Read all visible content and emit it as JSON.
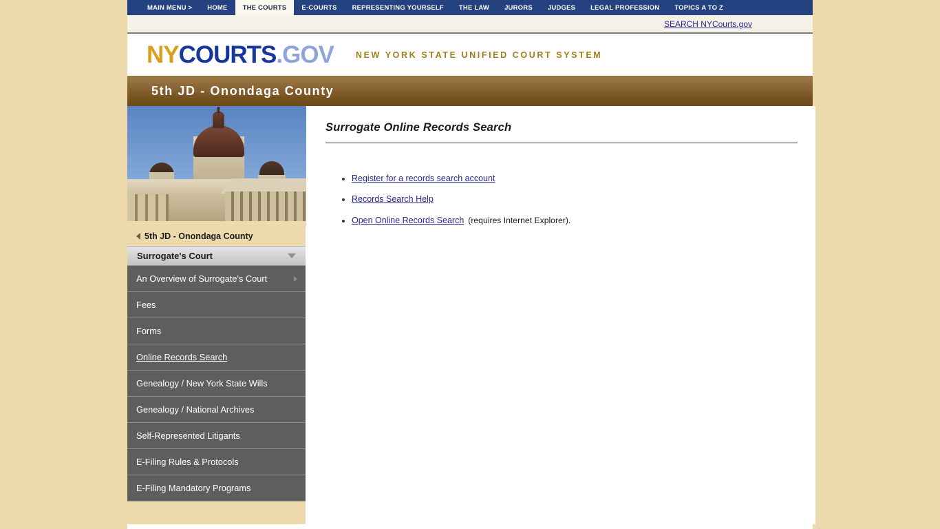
{
  "topnav": {
    "items": [
      {
        "label": "MAIN MENU >",
        "active": false
      },
      {
        "label": "HOME",
        "active": false
      },
      {
        "label": "THE COURTS",
        "active": true
      },
      {
        "label": "E-COURTS",
        "active": false
      },
      {
        "label": "REPRESENTING YOURSELF",
        "active": false
      },
      {
        "label": "THE LAW",
        "active": false
      },
      {
        "label": "JURORS",
        "active": false
      },
      {
        "label": "JUDGES",
        "active": false
      },
      {
        "label": "LEGAL PROFESSION",
        "active": false
      },
      {
        "label": "TOPICS A TO Z",
        "active": false
      }
    ]
  },
  "search": {
    "link_label": "SEARCH NYCourts.gov"
  },
  "logo": {
    "part_ny": "NY",
    "part_courts": "COURTS",
    "part_dot": ".",
    "part_gov": "GOV",
    "tagline": "NEW YORK STATE UNIFIED COURT SYSTEM",
    "color_ny": "#d9a01d",
    "color_courts": "#17379b",
    "color_gov": "#8fa4da",
    "color_tagline": "#a07e1a"
  },
  "title_bar": {
    "text": "5th JD - Onondaga County",
    "color_start": "#9c7a45",
    "color_end": "#6f4c1c"
  },
  "sidebar": {
    "hero_photo_alt": "Onondaga County Courthouse",
    "breadcrumb": {
      "label": "5th JD - Onondaga County",
      "icon": "triangle-left-icon"
    },
    "section_header": {
      "label": "Surrogate's Court",
      "icon": "triangle-down-icon"
    },
    "items": [
      {
        "label": "An Overview of Surrogate's Court",
        "has_submenu": true,
        "current": false
      },
      {
        "label": "Fees",
        "has_submenu": false,
        "current": false
      },
      {
        "label": "Forms",
        "has_submenu": false,
        "current": false
      },
      {
        "label": "Online Records Search",
        "has_submenu": false,
        "current": true
      },
      {
        "label": "Genealogy / New York State Wills",
        "has_submenu": false,
        "current": false
      },
      {
        "label": "Genealogy / National Archives",
        "has_submenu": false,
        "current": false
      },
      {
        "label": "Self-Represented Litigants",
        "has_submenu": false,
        "current": false
      },
      {
        "label": "E-Filing Rules & Protocols",
        "has_submenu": false,
        "current": false
      },
      {
        "label": "E-Filing Mandatory Programs",
        "has_submenu": false,
        "current": false
      }
    ]
  },
  "main": {
    "heading": "Surrogate Online Records Search",
    "links": [
      {
        "label": "Register for a records search account",
        "note": ""
      },
      {
        "label": "Records Search Help",
        "note": ""
      },
      {
        "label": "Open Online Records Search",
        "note": "(requires Internet Explorer)."
      }
    ],
    "link_color": "#28288c"
  }
}
